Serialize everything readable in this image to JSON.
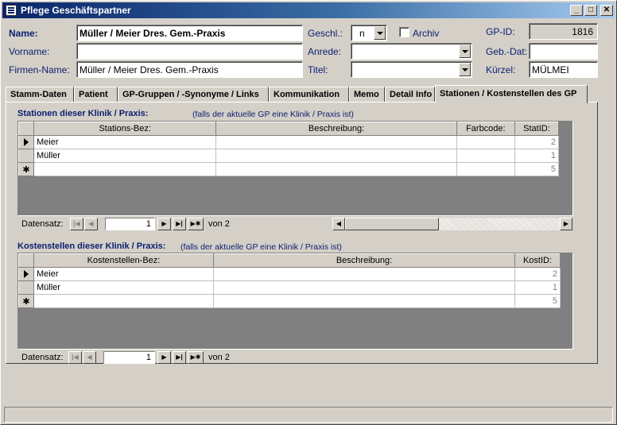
{
  "window": {
    "title": "Pflege Geschäftspartner",
    "minimize": "_",
    "maximize": "□",
    "close": "✕"
  },
  "header": {
    "name_label": "Name:",
    "name_value": "Müller / Meier Dres. Gem.-Praxis",
    "vorname_label": "Vorname:",
    "vorname_value": "",
    "firmenname_label": "Firmen-Name:",
    "firmenname_value": "Müller / Meier Dres. Gem.-Praxis",
    "geschl_label": "Geschl.:",
    "geschl_value": "n",
    "archiv_label": "Archiv",
    "anrede_label": "Anrede:",
    "anrede_value": "",
    "titel_label": "Titel:",
    "titel_value": "",
    "gpid_label": "GP-ID:",
    "gpid_value": "1816",
    "gebdat_label": "Geb.-Dat:",
    "gebdat_value": "",
    "kuerzel_label": "Kürzel:",
    "kuerzel_value": "MÜLMEI"
  },
  "tabs": [
    {
      "label": "Stamm-Daten"
    },
    {
      "label": "Patient"
    },
    {
      "label": "GP-Gruppen / -Synonyme / Links"
    },
    {
      "label": "Kommunikation"
    },
    {
      "label": "Memo"
    },
    {
      "label": "Detail Info"
    },
    {
      "label": "Stationen / Kostenstellen des GP"
    }
  ],
  "stations": {
    "title": "Stationen dieser Klinik / Praxis:",
    "note": "(falls der aktuelle GP eine Klinik / Praxis ist)",
    "columns": [
      "Stations-Bez:",
      "Beschreibung:",
      "Farbcode:",
      "StatID:"
    ],
    "rows": [
      {
        "bez": "Meier",
        "beschreibung": "",
        "farbcode": "",
        "id": "2"
      },
      {
        "bez": "Müller",
        "beschreibung": "",
        "farbcode": "",
        "id": "1"
      },
      {
        "bez": "",
        "beschreibung": "",
        "farbcode": "",
        "id": "5"
      }
    ],
    "nav": {
      "label": "Datensatz:",
      "current": "1",
      "of": "von  2"
    }
  },
  "kosten": {
    "title": "Kostenstellen dieser Klinik / Praxis:",
    "note": "(falls der aktuelle GP eine Klinik / Praxis ist)",
    "columns": [
      "Kostenstellen-Bez:",
      "Beschreibung:",
      "KostID:"
    ],
    "rows": [
      {
        "bez": "Meier",
        "beschreibung": "",
        "id": "2"
      },
      {
        "bez": "Müller",
        "beschreibung": "",
        "id": "1"
      },
      {
        "bez": "",
        "beschreibung": "",
        "id": "5"
      }
    ],
    "nav": {
      "label": "Datensatz:",
      "current": "1",
      "of": "von  2"
    }
  }
}
